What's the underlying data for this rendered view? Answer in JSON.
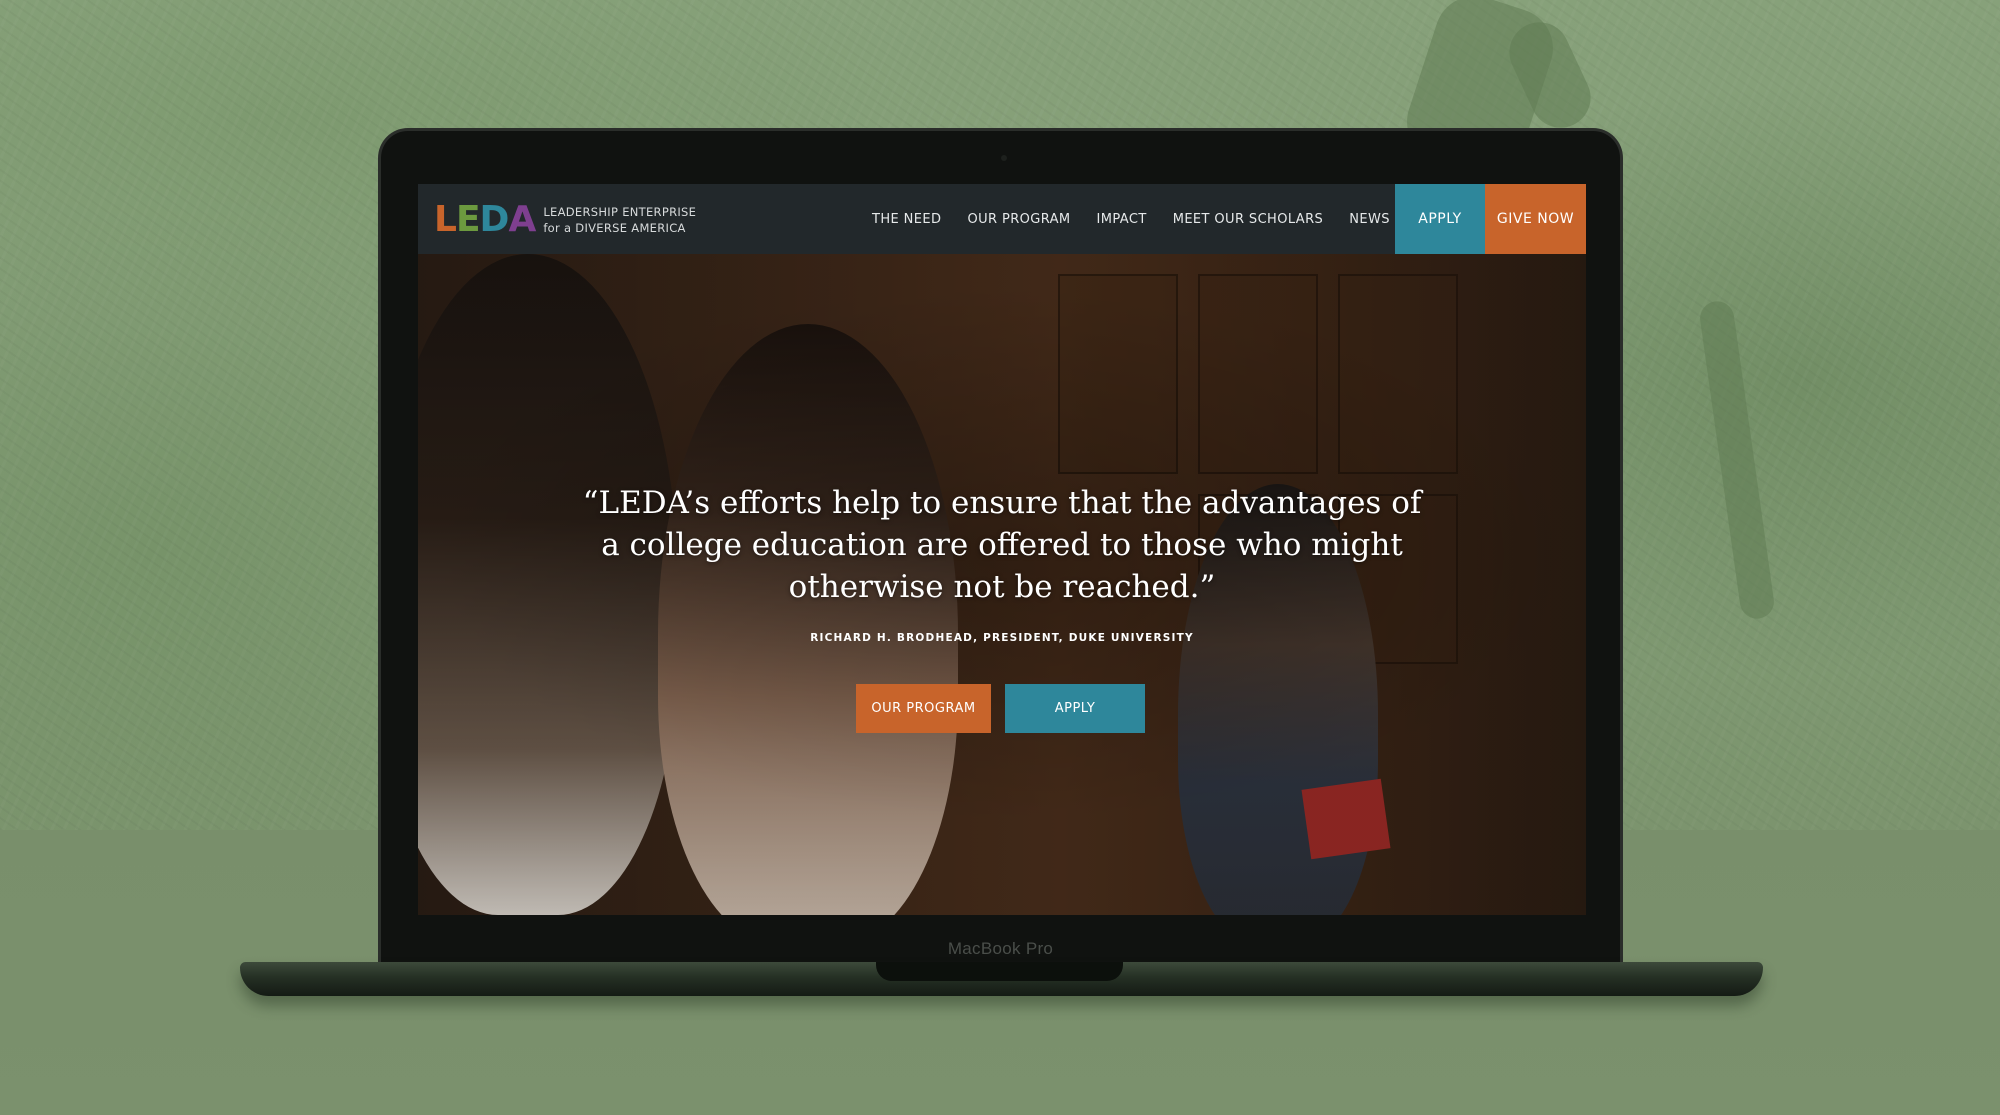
{
  "device": {
    "model_label": "MacBook Pro"
  },
  "site": {
    "logo": {
      "letters": [
        {
          "char": "L",
          "color": "#c8642b"
        },
        {
          "char": "E",
          "color": "#6c9a3f"
        },
        {
          "char": "D",
          "color": "#2e879b"
        },
        {
          "char": "A",
          "color": "#7e3f8f"
        }
      ],
      "tagline_line1": "LEADERSHIP ENTERPRISE",
      "tagline_line2": "for a DIVERSE AMERICA"
    },
    "nav": {
      "links": [
        "THE NEED",
        "OUR PROGRAM",
        "IMPACT",
        "MEET OUR SCHOLARS",
        "NEWS & PRESS"
      ],
      "apply_label": "APPLY",
      "give_label": "GIVE NOW"
    },
    "hero": {
      "quote": "“LEDA’s efforts help to ensure that the advantages of a college education are offered to those who might otherwise not be reached.”",
      "attribution": "RICHARD H. BRODHEAD, PRESIDENT, DUKE UNIVERSITY",
      "primary_button": "OUR PROGRAM",
      "secondary_button": "APPLY"
    }
  },
  "colors": {
    "orange": "#c8642b",
    "teal": "#2e879b",
    "nav_bg": "#22282b",
    "backdrop_green": "#7d9470"
  }
}
